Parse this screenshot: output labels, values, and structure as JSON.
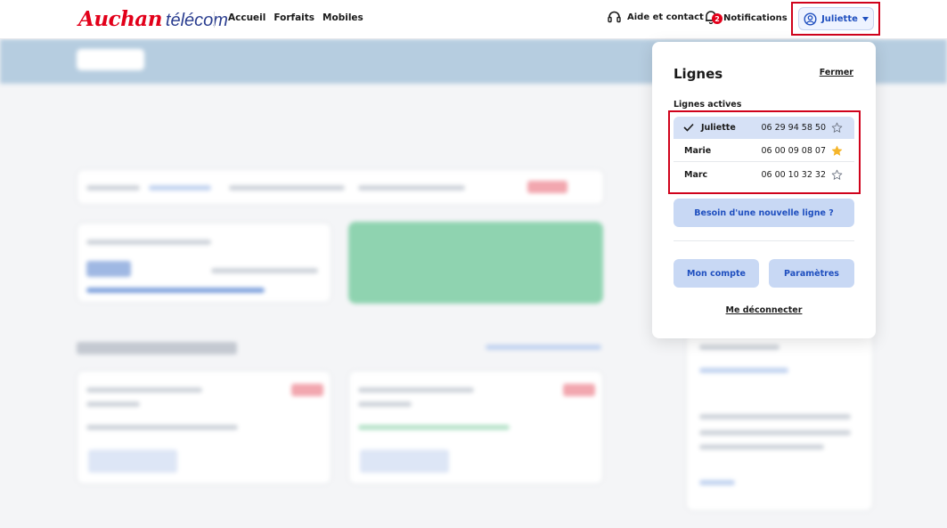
{
  "brand": {
    "part1": "Auchan",
    "part2": "télécom"
  },
  "nav": [
    {
      "label": "Accueil"
    },
    {
      "label": "Forfaits"
    },
    {
      "label": "Mobiles"
    }
  ],
  "header": {
    "help_label": "Aide et contact",
    "notifications_label": "Notifications",
    "notifications_count": "2",
    "user_name": "Juliette"
  },
  "panel": {
    "title": "Lignes",
    "close_label": "Fermer",
    "section_label": "Lignes actives",
    "lines": [
      {
        "name": "Juliette",
        "number": "06 29 94 58 50",
        "favorite": false,
        "selected": true
      },
      {
        "name": "Marie",
        "number": "06 00 09 08 07",
        "favorite": true,
        "selected": false
      },
      {
        "name": "Marc",
        "number": "06 00 10 32 32",
        "favorite": false,
        "selected": false
      }
    ],
    "new_line_label": "Besoin d'une nouvelle ligne ?",
    "account_label": "Mon compte",
    "settings_label": "Paramètres",
    "logout_label": "Me déconnecter"
  },
  "colors": {
    "brand_red": "#e2001a",
    "brand_blue": "#2a3d8f",
    "accent_blue": "#1f4fbf",
    "star_gold": "#f5b52a"
  }
}
